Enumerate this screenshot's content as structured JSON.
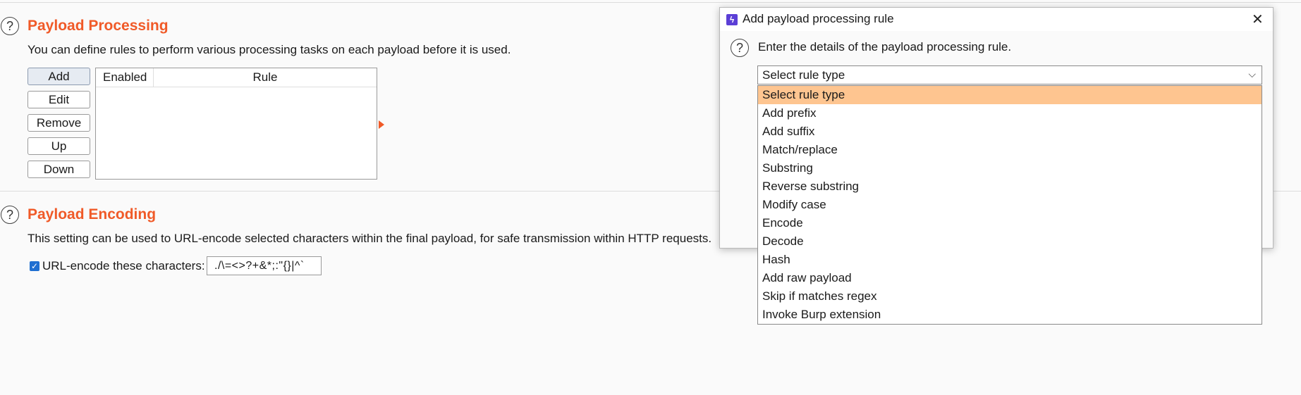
{
  "processing": {
    "title": "Payload Processing",
    "description": "You can define rules to perform various processing tasks on each payload before it is used.",
    "buttons": {
      "add": "Add",
      "edit": "Edit",
      "remove": "Remove",
      "up": "Up",
      "down": "Down"
    },
    "table": {
      "col_enabled": "Enabled",
      "col_rule": "Rule"
    }
  },
  "encoding": {
    "title": "Payload Encoding",
    "description": "This setting can be used to URL-encode selected characters within the final payload, for safe transmission within HTTP requests.",
    "checkbox_label": "URL-encode these characters:",
    "checkbox_checked": true,
    "characters": "./\\=<>?+&*;:\"{}|^`"
  },
  "dialog": {
    "title": "Add payload processing rule",
    "prompt": "Enter the details of the payload processing rule.",
    "select_value": "Select rule type",
    "options": [
      "Select rule type",
      "Add prefix",
      "Add suffix",
      "Match/replace",
      "Substring",
      "Reverse substring",
      "Modify case",
      "Encode",
      "Decode",
      "Hash",
      "Add raw payload",
      "Skip if matches regex",
      "Invoke Burp extension"
    ],
    "highlight_color": "#fec590"
  },
  "icons": {
    "help": "?",
    "close": "✕",
    "chevron": "⌵",
    "check": "✓",
    "logo": "ϟ"
  },
  "colors": {
    "accent": "#f05a28",
    "checkbox": "#1f6fd1"
  }
}
